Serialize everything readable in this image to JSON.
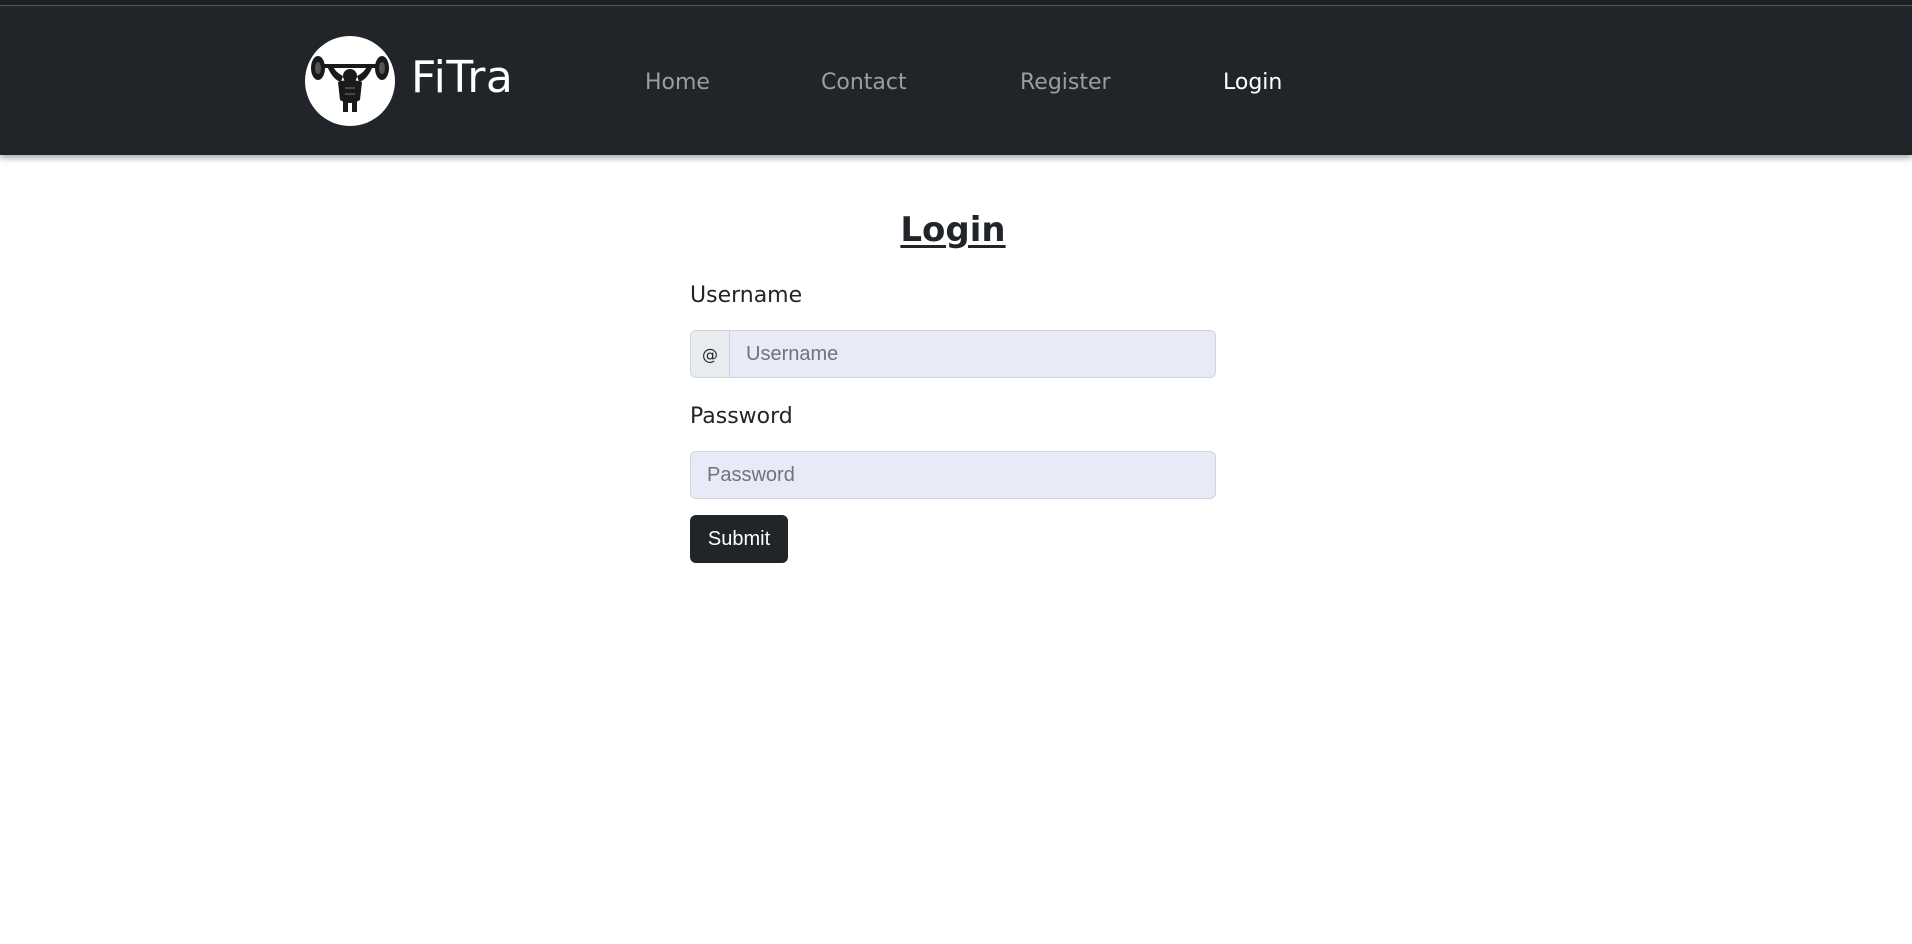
{
  "brand": {
    "name": "FiTra",
    "logo_icon": "weightlifter-logo-icon"
  },
  "nav": {
    "items": [
      {
        "label": "Home",
        "active": false
      },
      {
        "label": "Contact",
        "active": false
      },
      {
        "label": "Register",
        "active": false
      },
      {
        "label": "Login",
        "active": true
      }
    ]
  },
  "page": {
    "title": "Login"
  },
  "form": {
    "username_label": "Username",
    "username_prefix": "@",
    "username_placeholder": "Username",
    "username_value": "",
    "password_label": "Password",
    "password_placeholder": "Password",
    "password_value": "",
    "submit_label": "Submit"
  },
  "colors": {
    "navbar_bg": "#212529",
    "input_bg": "#e8eaf7",
    "button_bg": "#212529"
  }
}
